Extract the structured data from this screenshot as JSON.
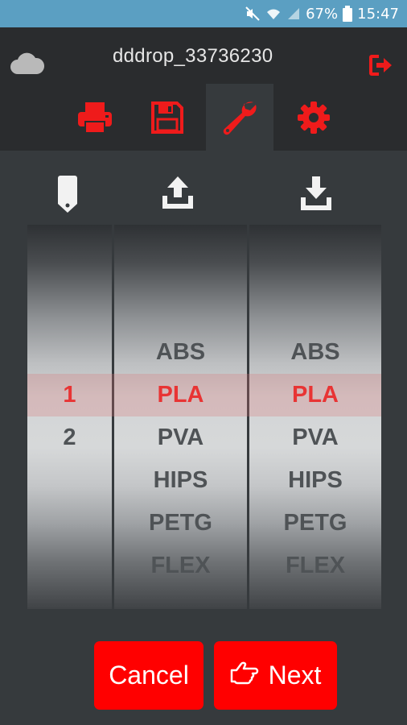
{
  "status_bar": {
    "battery_percent": "67%",
    "time": "15:47",
    "icons": [
      "mute-icon",
      "wifi-icon",
      "signal-icon",
      "battery-icon"
    ]
  },
  "header": {
    "device_name": "dddrop_33736230",
    "cloud_icon": "cloud-icon",
    "logout_icon": "logout-icon"
  },
  "toolbar": {
    "items": [
      {
        "icon": "print-icon",
        "active": false
      },
      {
        "icon": "save-icon",
        "active": false
      },
      {
        "icon": "wrench-icon",
        "active": true
      },
      {
        "icon": "gear-icon",
        "active": false
      }
    ]
  },
  "columns": {
    "icons": [
      "tag-icon",
      "upload-icon",
      "download-icon"
    ]
  },
  "pickers": {
    "extruder": {
      "options": [
        "1",
        "2"
      ],
      "selected": "1"
    },
    "unload": {
      "options": [
        "ABS",
        "PLA",
        "PVA",
        "HIPS",
        "PETG",
        "FLEX"
      ],
      "selected": "PLA"
    },
    "load": {
      "options": [
        "ABS",
        "PLA",
        "PVA",
        "HIPS",
        "PETG",
        "FLEX"
      ],
      "selected": "PLA"
    }
  },
  "actions": {
    "cancel_label": "Cancel",
    "next_label": "Next",
    "next_icon": "hand-point-right-icon"
  },
  "colors": {
    "accent": "#ff0000",
    "status_bar": "#5b9fc2",
    "background": "#2a2c2e",
    "panel": "#363a3d"
  }
}
